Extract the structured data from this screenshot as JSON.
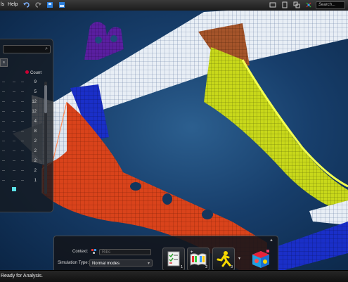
{
  "menubar": {
    "items": [
      {
        "label": "ls"
      },
      {
        "label": "Help"
      }
    ],
    "search_placeholder": "Search..."
  },
  "panel": {
    "tab_label": "s",
    "count_header": "Count",
    "rows": [
      {
        "count": "9"
      },
      {
        "count": "5"
      },
      {
        "count": "12"
      },
      {
        "count": "12"
      },
      {
        "count": "4"
      },
      {
        "count": "8"
      },
      {
        "count": "2"
      },
      {
        "count": "2"
      },
      {
        "count": "2"
      },
      {
        "count": "2"
      },
      {
        "count": "1"
      }
    ]
  },
  "dock": {
    "context_label": "Context:",
    "context_placeholder": "Ribs",
    "simulation_type_label": "Simulation Type:",
    "simulation_type_value": "Normal modes",
    "tools": [
      {
        "name": "checklist-tool",
        "number": "1"
      },
      {
        "name": "book-tool",
        "number": "2"
      },
      {
        "name": "run-tool",
        "number": "3"
      },
      {
        "name": "results-tool",
        "number": ""
      }
    ]
  },
  "status": {
    "text": "Ready for Analysis."
  },
  "colors": {
    "mesh_red": "#d9431b",
    "mesh_yellow": "#c8d81a",
    "mesh_white": "#e8eef5",
    "mesh_blue": "#1a2fc8",
    "mesh_brown": "#a5542a",
    "mesh_purple": "#5a1fa0",
    "viewport_bg": "#1d4a7a"
  }
}
